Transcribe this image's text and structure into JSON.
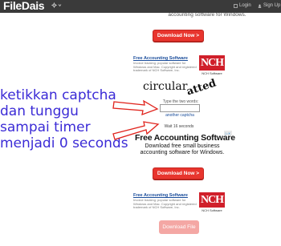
{
  "header": {
    "brand": "FileDais",
    "brand_menu_icon": "gear-icon",
    "login_label": "Login",
    "signup_label": "Sign Up"
  },
  "main": {
    "top_ad_text": "accounting software for Windows.",
    "download_button_label": "Download Now >",
    "ad_top": {
      "title": "Free Accounting Software",
      "description": "Invoice tracking; popular software for Windows and Mac. Copyright and registered trademark of NCH Software, Inc.",
      "logo_text": "NCH",
      "logo_sub": "NCH Software"
    },
    "captcha": {
      "word1": "circular",
      "word2": "atted",
      "label": "Type the two words:",
      "input_value": "",
      "another_link": "another captcha",
      "wait_text": "Wait 16 seconds"
    },
    "big_ad": {
      "title": "Free Accounting Software",
      "text": "Download free small business accounting software for Windows.",
      "adchoices": "▷✕"
    },
    "download_button_label_2": "Download Now >",
    "ad_bottom": {
      "title": "Free Accounting Software",
      "description": "Invoice tracking; popular software for Windows and Mac. Copyright and registered trademark of NCH Software, Inc.",
      "logo_text": "NCH",
      "logo_sub": "NCH Software"
    },
    "download_file_label": "Download File"
  },
  "annotation": {
    "lines": [
      "ketikkan captcha",
      "dan tunggu",
      "sampai timer",
      "menjadi 0 seconds"
    ],
    "color": "#3b2bd6",
    "arrow_color": "#e0231c"
  }
}
